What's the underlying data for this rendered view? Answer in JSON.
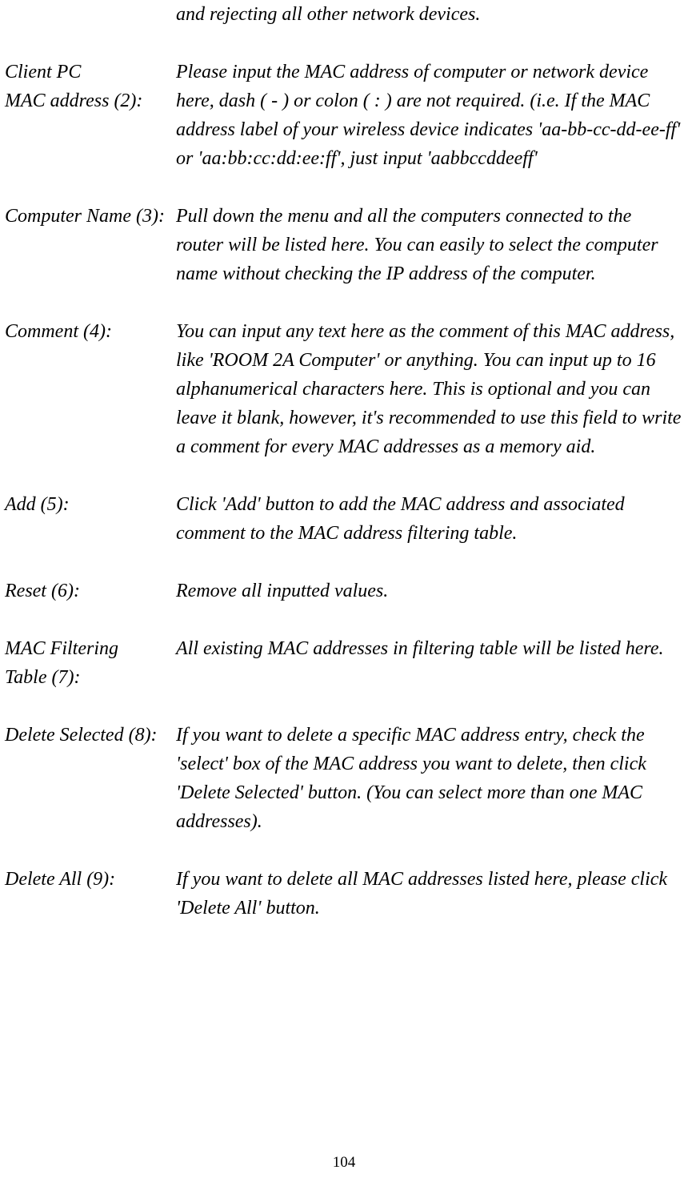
{
  "intro": "and rejecting all other network devices.",
  "entries": [
    {
      "label_line1": "Client PC",
      "label_line2": "MAC address (2):",
      "desc": "Please input the MAC address of computer or network device here, dash ( - ) or colon ( : ) are not required. (i.e. If the MAC address label of your wireless device indicates 'aa-bb-cc-dd-ee-ff' or 'aa:bb:cc:dd:ee:ff', just input 'aabbccddeeff'"
    },
    {
      "label_line1": "Computer Name (3):",
      "label_line2": "",
      "desc": "Pull down the menu and all the computers connected to the router will be listed here. You can easily to select the computer name without checking the IP address of the computer."
    },
    {
      "label_line1": "Comment (4):",
      "label_line2": "",
      "desc": "You can input any text here as the comment of this MAC address, like 'ROOM 2A Computer' or anything. You can input up to 16 alphanumerical characters here. This is optional and you can leave it blank, however, it's recommended to use this field to write a comment for every MAC addresses as a memory aid."
    },
    {
      "label_line1": "Add (5):",
      "label_line2": "",
      "desc": "Click 'Add' button to add the MAC address and associated comment to the MAC address filtering table."
    },
    {
      "label_line1": "Reset (6):",
      "label_line2": "",
      "desc": "Remove all inputted values."
    },
    {
      "label_line1": "MAC Filtering",
      "label_line2": "Table (7):",
      "desc": "All existing MAC addresses in filtering table will be listed here."
    },
    {
      "label_line1": "Delete Selected (8):",
      "label_line2": "",
      "desc": "If you want to delete a specific MAC address entry, check the 'select' box of the MAC address you want to delete, then click 'Delete Selected' button. (You can select more than one MAC addresses)."
    },
    {
      "label_line1": "Delete All (9):",
      "label_line2": "",
      "desc": "If you want to delete all MAC addresses listed here, please click 'Delete All' button."
    }
  ],
  "page_number": "104"
}
